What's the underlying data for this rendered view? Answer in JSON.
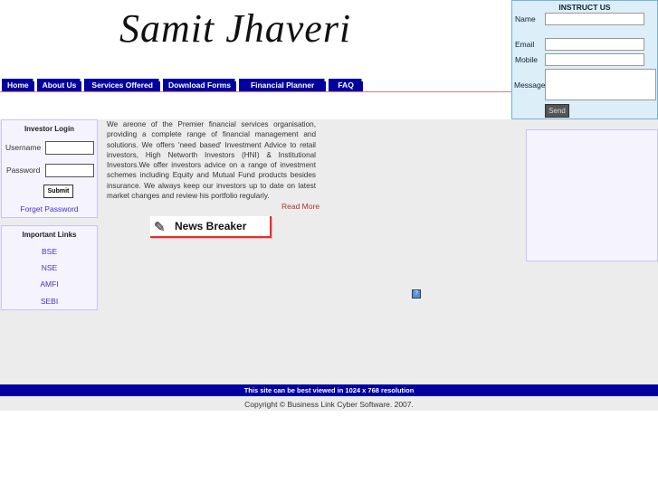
{
  "header": {
    "logo": "Samit  Jhaveri"
  },
  "nav": [
    "Home",
    "About Us",
    "Services Offered",
    "Download Forms",
    "Financial Planner",
    "FAQ"
  ],
  "instruct": {
    "title": "INSTRUCT US",
    "name": "Name",
    "email": "Email",
    "mobile": "Mobile",
    "message": "Message",
    "send": "Send"
  },
  "login": {
    "title": "Investor Login",
    "username": "Username",
    "password": "Password",
    "submit": "Submit",
    "forgot": "Forget Password"
  },
  "links": {
    "title": "Important Links",
    "items": [
      "BSE",
      "NSE",
      "AMFI",
      "SEBI"
    ]
  },
  "about": {
    "text": "We areone of the Premier financial services organisation, providing a complete range of financial management and solutions. We offers 'need based' Investment Advice to retail investors, High Networth Investors (HNI) & Institutional Investors.We offer investors advice on a range of investment schemes including Equity and Mutual Fund products besides insurance. We always keep our investors up to date on latest market changes and review his portfolio regularly.",
    "read_more": "Read More"
  },
  "news_breaker": "News Breaker",
  "footer": {
    "resolution": "This site can be best viewed in 1024 x 768 resolution",
    "copyright": "Copyright © Business Link Cyber Software. 2007."
  }
}
